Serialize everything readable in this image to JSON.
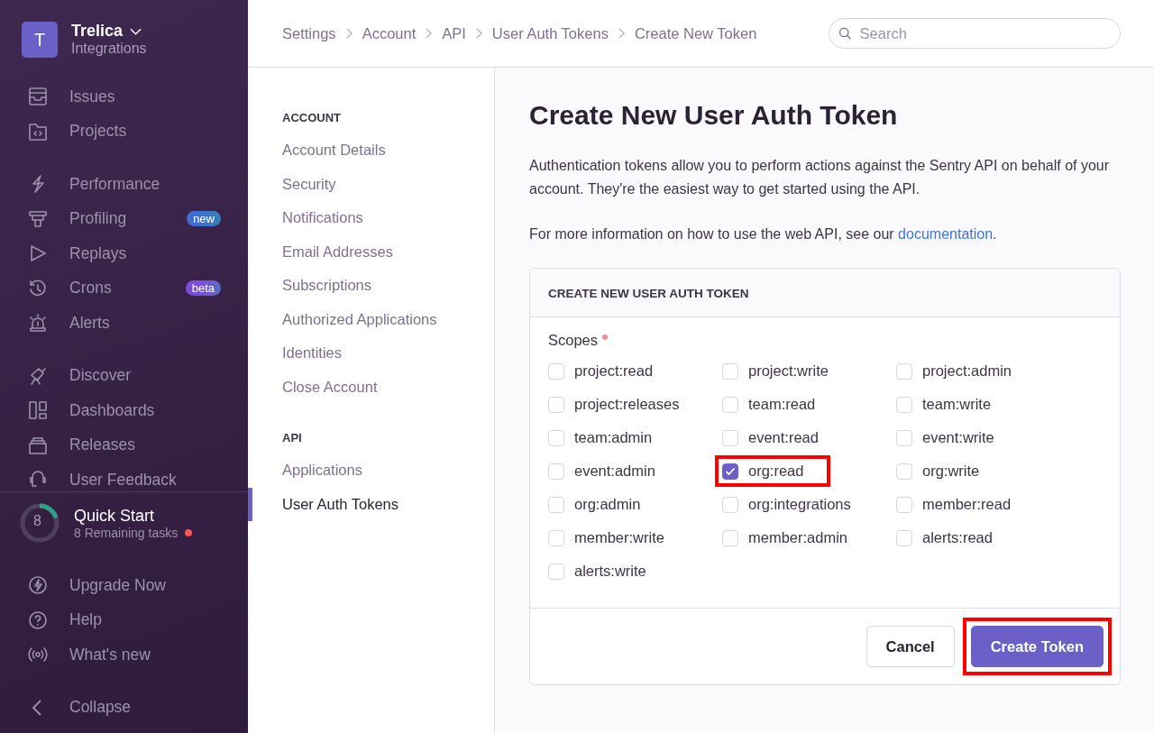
{
  "org": {
    "initial": "T",
    "name": "Trelica",
    "subtitle": "Integrations"
  },
  "sidebar": {
    "groups": [
      [
        {
          "label": "Issues"
        },
        {
          "label": "Projects"
        }
      ],
      [
        {
          "label": "Performance"
        },
        {
          "label": "Profiling",
          "badge": "new",
          "color": "#3e6ed4"
        },
        {
          "label": "Replays"
        },
        {
          "label": "Crons",
          "badge": "beta",
          "color": "#7b4ce0"
        },
        {
          "label": "Alerts"
        }
      ],
      [
        {
          "label": "Discover"
        },
        {
          "label": "Dashboards"
        },
        {
          "label": "Releases"
        },
        {
          "label": "User Feedback"
        }
      ]
    ],
    "quick_start": {
      "count": "8",
      "title": "Quick Start",
      "subtitle": "8 Remaining tasks",
      "level": 0.2
    },
    "bottom": [
      {
        "label": "Upgrade Now"
      },
      {
        "label": "Help"
      },
      {
        "label": "What's new"
      }
    ],
    "collapse": "Collapse"
  },
  "breadcrumbs": [
    "Settings",
    "Account",
    "API",
    "User Auth Tokens",
    "Create New Token"
  ],
  "search": {
    "placeholder": "Search"
  },
  "settings_nav": [
    {
      "heading": "ACCOUNT",
      "items": [
        {
          "label": "Account Details",
          "selected": false
        },
        {
          "label": "Security",
          "selected": false
        },
        {
          "label": "Notifications",
          "selected": false
        },
        {
          "label": "Email Addresses",
          "selected": false
        },
        {
          "label": "Subscriptions",
          "selected": false
        },
        {
          "label": "Authorized Applications",
          "selected": false
        },
        {
          "label": "Identities",
          "selected": false
        },
        {
          "label": "Close Account",
          "selected": false
        }
      ]
    },
    {
      "heading": "API",
      "items": [
        {
          "label": "Applications",
          "selected": false
        },
        {
          "label": "User Auth Tokens",
          "selected": true
        }
      ]
    }
  ],
  "page": {
    "title": "Create New User Auth Token",
    "intro": "Authentication tokens allow you to perform actions against the Sentry API on behalf of your account. They're the easiest way to get started using the API.",
    "more_info": "For more information on how to use the web API, see our",
    "link": "documentation",
    "link_after": "."
  },
  "panel": {
    "title": "CREATE NEW USER AUTH TOKEN",
    "scopes_label": "Scopes",
    "required": true,
    "scopes": [
      {
        "label": "project:read",
        "checked": false,
        "highlighted": false
      },
      {
        "label": "project:write",
        "checked": false,
        "highlighted": false
      },
      {
        "label": "project:admin",
        "checked": false,
        "highlighted": false
      },
      {
        "label": "project:releases",
        "checked": false,
        "highlighted": false
      },
      {
        "label": "team:read",
        "checked": false,
        "highlighted": false
      },
      {
        "label": "team:write",
        "checked": false,
        "highlighted": false
      },
      {
        "label": "team:admin",
        "checked": false,
        "highlighted": false
      },
      {
        "label": "event:read",
        "checked": false,
        "highlighted": false
      },
      {
        "label": "event:write",
        "checked": false,
        "highlighted": false
      },
      {
        "label": "event:admin",
        "checked": false,
        "highlighted": false
      },
      {
        "label": "org:read",
        "checked": true,
        "highlighted": true
      },
      {
        "label": "org:write",
        "checked": false,
        "highlighted": false
      },
      {
        "label": "org:admin",
        "checked": false,
        "highlighted": false
      },
      {
        "label": "org:integrations",
        "checked": false,
        "highlighted": false
      },
      {
        "label": "member:read",
        "checked": false,
        "highlighted": false
      },
      {
        "label": "member:write",
        "checked": false,
        "highlighted": false
      },
      {
        "label": "member:admin",
        "checked": false,
        "highlighted": false
      },
      {
        "label": "alerts:read",
        "checked": false,
        "highlighted": false
      },
      {
        "label": "alerts:write",
        "checked": false,
        "highlighted": false
      }
    ],
    "buttons": [
      {
        "label": "Cancel",
        "kind": "secondary",
        "highlighted": false
      },
      {
        "label": "Create Token",
        "kind": "primary",
        "highlighted": true
      }
    ]
  }
}
